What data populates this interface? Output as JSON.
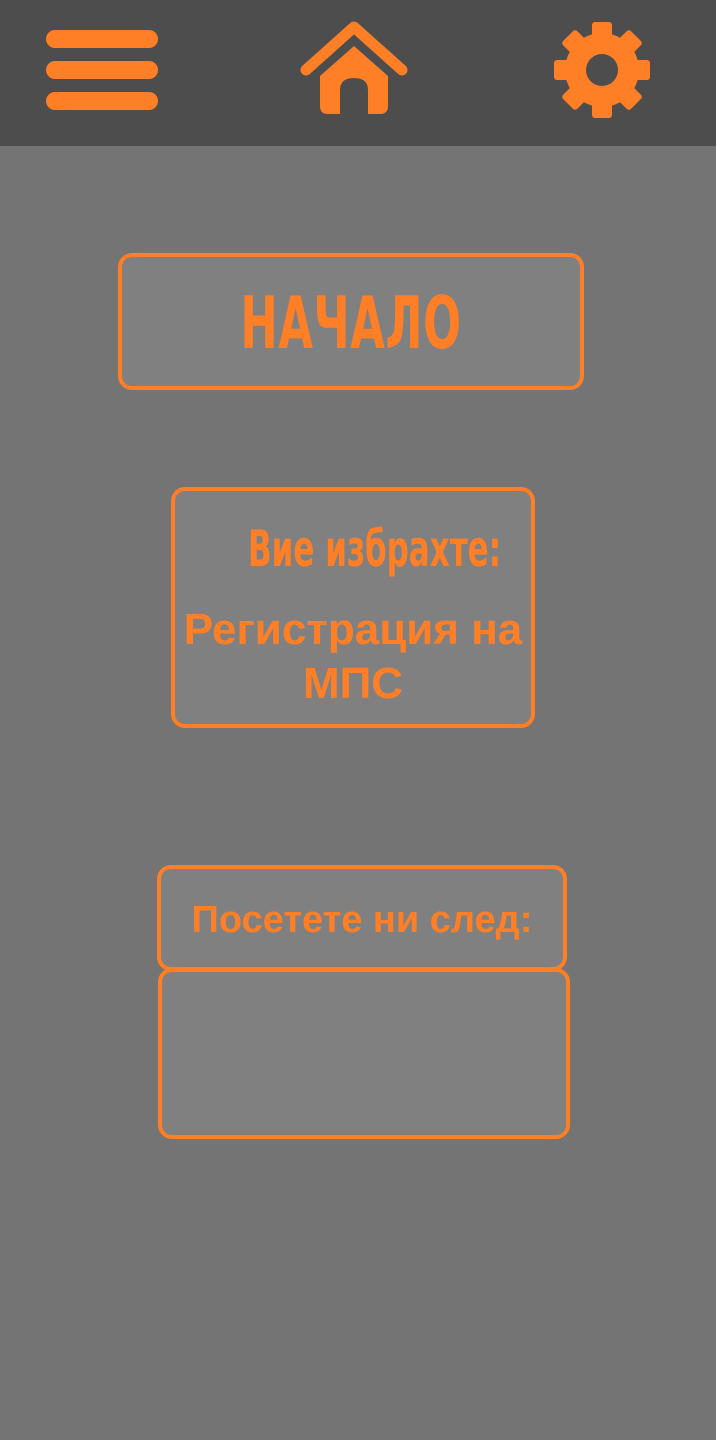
{
  "colors": {
    "accent": "#ff7f27",
    "topbar_bg": "#4d4d4d",
    "page_bg": "#747474",
    "box_bg": "#808080"
  },
  "topbar": {
    "menu_icon": "hamburger-menu-icon",
    "home_icon": "home-icon",
    "settings_icon": "gear-icon"
  },
  "main": {
    "title": "НАЧАЛО",
    "selection_heading": "Вие избрахте:",
    "selection_value": "Регистрация на МПС",
    "visit_label": "Посетете ни след:",
    "visit_value": ""
  }
}
